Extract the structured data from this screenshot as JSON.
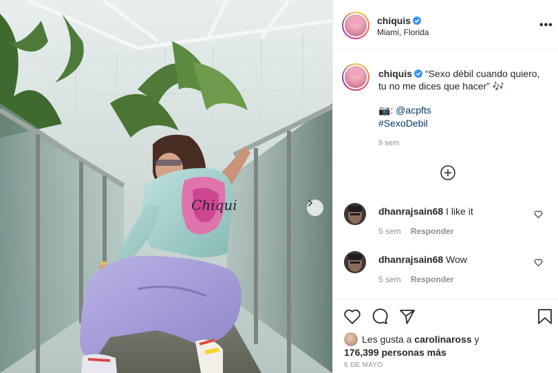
{
  "post": {
    "username": "chiquis",
    "location": "Miami, Florida",
    "more_label": "•••",
    "caption_line1": "“Sexo débil cuando quiero,",
    "caption_line2": "tu no me dices que hacer”",
    "caption_emoji": "🎶",
    "credit_prefix": "📷: ",
    "credit_handle": "@acpfts",
    "hashtag": "#SexoDebil",
    "time_ago": "9 sem",
    "liked_by_prefix": "Les gusta a ",
    "liked_by_user": "carolinaross",
    "liked_by_connector": " y",
    "liked_by_count": "176,399 personas más",
    "date": "6 DE MAYO"
  },
  "comments": [
    {
      "username": "dhanrajsain68",
      "text": "I like it",
      "time": "5 sem",
      "reply_label": "Responder"
    },
    {
      "username": "dhanrajsain68",
      "text": "Wow",
      "time": "5 sem",
      "reply_label": "Responder"
    }
  ],
  "icons": {
    "verified": "verified-badge-icon",
    "load_more": "plus-circle-icon",
    "heart": "heart-icon",
    "comment": "comment-icon",
    "share": "paper-plane-icon",
    "save": "bookmark-icon",
    "next": "chevron-right-icon"
  },
  "colors": {
    "verified_blue": "#3897f0",
    "link_blue": "#00376b",
    "muted_text": "#8e8e8e",
    "border": "#efefef"
  }
}
